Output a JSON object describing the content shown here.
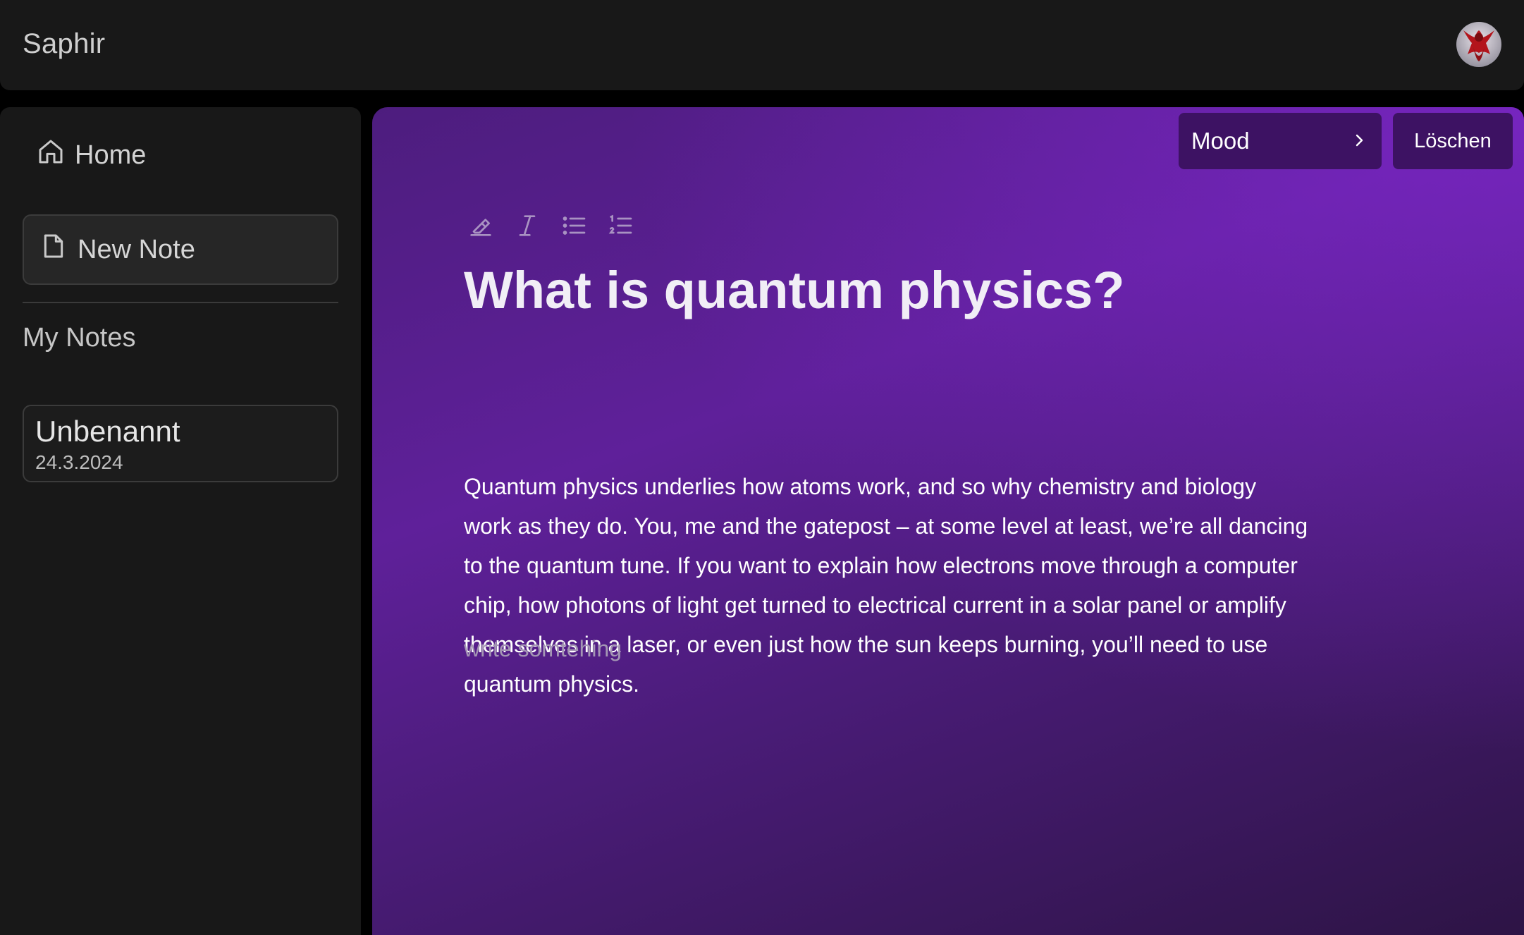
{
  "app": {
    "name": "Saphir"
  },
  "header": {
    "avatar_icon": "user-avatar-icon"
  },
  "sidebar": {
    "home_label": "Home",
    "new_note_label": "New Note",
    "section_title": "My Notes",
    "notes": [
      {
        "title": "Unbenannt",
        "date": "24.3.2024"
      }
    ]
  },
  "editor": {
    "mood_label": "Mood",
    "delete_label": "Löschen",
    "toolbar": [
      "highlight-icon",
      "italic-icon",
      "bullet-list-icon",
      "numbered-list-icon"
    ],
    "title": "What is quantum physics?",
    "body": "Quantum physics underlies how atoms work, and so why chemistry and biology work as they do. You, me and the gatepost – at some level at least, we’re all dancing to the quantum tune. If you want to explain how electrons move through a computer chip, how photons of light get turned to electrical current in a solar panel or amplify themselves in a laser, or even just how the sun keeps burning, you’ll need to use quantum physics.",
    "placeholder": "write somtehing"
  },
  "colors": {
    "background": "#000000",
    "panel": "#181818",
    "accent_purple": "#5f209a",
    "button_purple": "#3d1263"
  }
}
